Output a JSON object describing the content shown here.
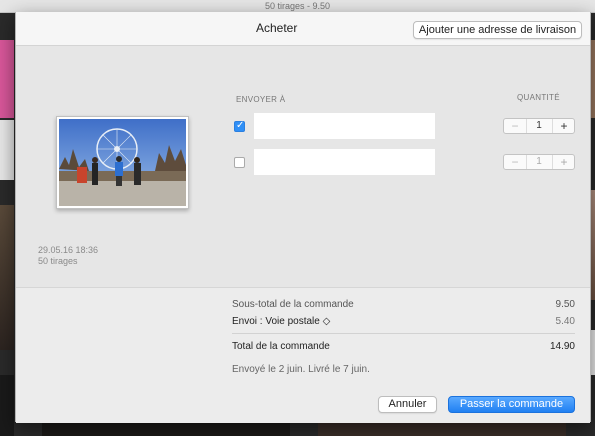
{
  "background": {
    "window_title": "50 tirages - 9.50"
  },
  "sheet": {
    "title": "Acheter",
    "add_address_label": "Ajouter une adresse de livraison"
  },
  "photo": {
    "date": "29.05.16 18:36",
    "prints": "50 tirages"
  },
  "columns": {
    "send_to": "ENVOYER À",
    "quantity": "QUANTITÉ"
  },
  "recipients": [
    {
      "checked": true,
      "address": "",
      "quantity": "1",
      "minus": "−",
      "plus": "+"
    },
    {
      "checked": false,
      "address": "",
      "quantity": "1",
      "minus": "−",
      "plus": "+"
    }
  ],
  "summary": {
    "subtotal_label": "Sous-total de la commande",
    "subtotal_value": "9.50",
    "shipping_label": "Envoi : Voie postale ◇",
    "shipping_value": "5.40",
    "total_label": "Total de la commande",
    "total_value": "14.90",
    "delivery_note": "Envoyé le 2 juin. Livré le 7 juin."
  },
  "buttons": {
    "cancel": "Annuler",
    "order": "Passer la commande"
  },
  "colors": {
    "accent": "#2f8ff6",
    "primary_button": "#2080f2"
  }
}
